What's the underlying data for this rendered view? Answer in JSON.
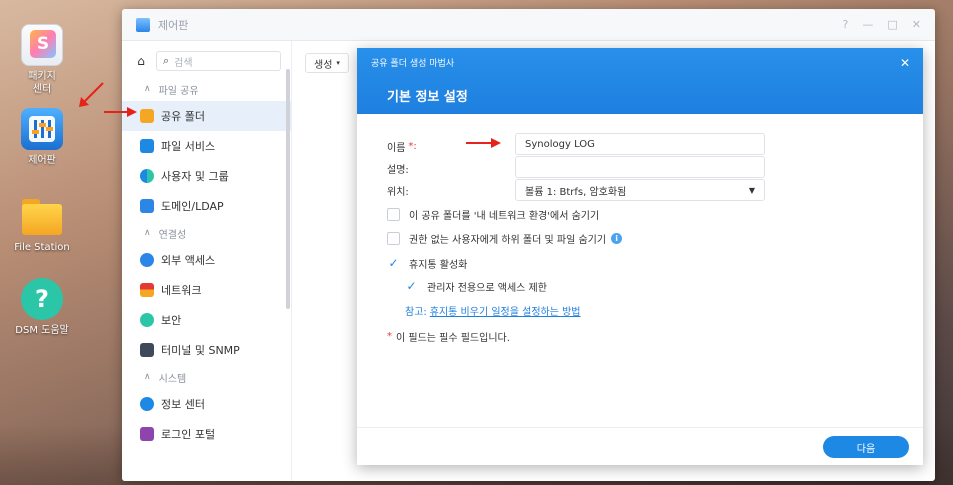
{
  "desktop": {
    "icons": [
      {
        "label_line1": "패키지",
        "label_line2": "센터",
        "icon": "package-center-icon"
      },
      {
        "label_line1": "제어판",
        "label_line2": "",
        "icon": "control-panel-icon"
      },
      {
        "label_line1": "File Station",
        "label_line2": "",
        "icon": "file-station-icon"
      },
      {
        "label_line1": "DSM 도움말",
        "label_line2": "",
        "icon": "dsm-help-icon"
      }
    ]
  },
  "control_panel": {
    "title": "제어판",
    "search_placeholder": "검색",
    "window_controls": [
      "?",
      "—",
      "□",
      "✕"
    ],
    "create_button": "생성",
    "sidebar": {
      "sections": [
        {
          "label": "파일 공유",
          "items": [
            {
              "label": "공유 폴더",
              "icon": "shared-folder-icon",
              "active": true
            },
            {
              "label": "파일 서비스",
              "icon": "file-services-icon",
              "active": false
            },
            {
              "label": "사용자 및 그룹",
              "icon": "user-group-icon",
              "active": false
            },
            {
              "label": "도메인/LDAP",
              "icon": "domain-ldap-icon",
              "active": false
            }
          ]
        },
        {
          "label": "연결성",
          "items": [
            {
              "label": "외부 액세스",
              "icon": "external-access-icon",
              "active": false
            },
            {
              "label": "네트워크",
              "icon": "network-icon",
              "active": false
            },
            {
              "label": "보안",
              "icon": "security-icon",
              "active": false
            },
            {
              "label": "터미널 및 SNMP",
              "icon": "terminal-snmp-icon",
              "active": false
            }
          ]
        },
        {
          "label": "시스템",
          "items": [
            {
              "label": "정보 센터",
              "icon": "info-center-icon",
              "active": false
            },
            {
              "label": "로그인 포털",
              "icon": "login-portal-icon",
              "active": false
            }
          ]
        }
      ]
    }
  },
  "wizard": {
    "title": "공유 폴더 생성 마법사",
    "subtitle": "기본 정보 설정",
    "close": "✕",
    "fields": {
      "name_label": "이름",
      "name_required_mark": "*:",
      "name_value": "Synology LOG",
      "description_label": "설명:",
      "description_value": "",
      "location_label": "위치:",
      "location_value": "볼륨 1:  Btrfs, 암호화됨"
    },
    "options": {
      "hide_network": {
        "label": "이 공유 폴더를 '내 네트워크 환경'에서 숨기기",
        "checked": false
      },
      "hide_unauthorized": {
        "label": "권한 없는 사용자에게 하위 폴더 및 파일 숨기기",
        "checked": false
      },
      "enable_recycle": {
        "label": "휴지통 활성화",
        "checked": true
      },
      "admin_only": {
        "label": "관리자 전용으로 액세스 제한",
        "checked": true
      }
    },
    "note_prefix": "참고:",
    "note_link": "휴지통 비우기 일정을 설정하는 방법",
    "required_note_mark": "*",
    "required_note": "이 필드는 필수 필드입니다.",
    "next_button": "다음"
  },
  "colors": {
    "accent": "#1e88e5",
    "annotation_arrow": "#e5231b"
  }
}
